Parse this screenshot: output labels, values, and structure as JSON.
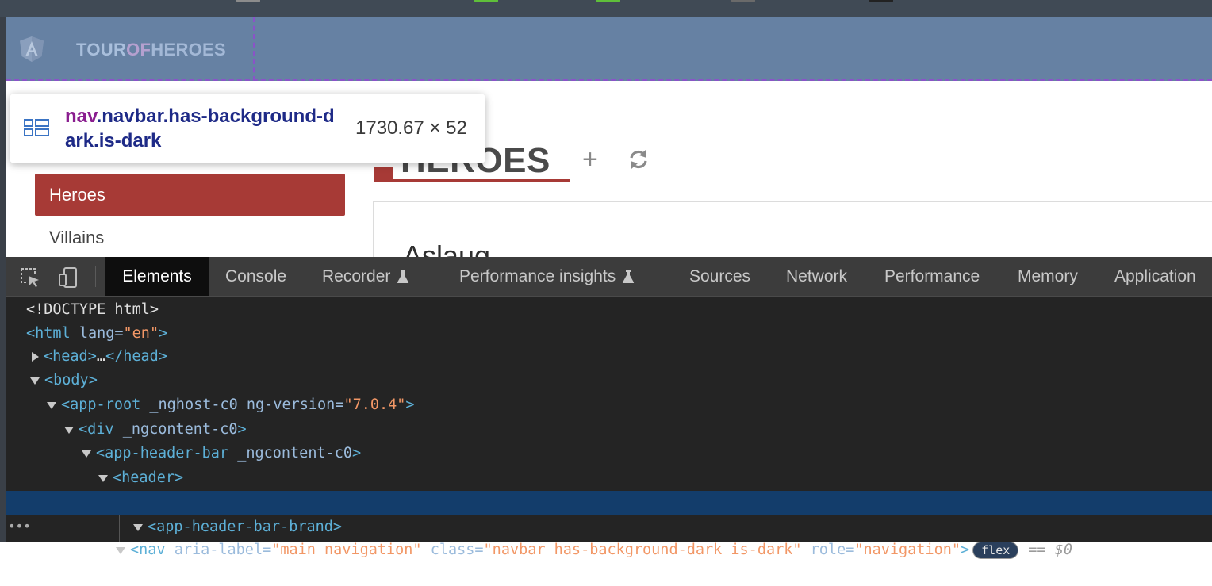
{
  "colors": {
    "navbar_bg": "#6681a3",
    "highlight_outline": "#8a53c8",
    "accent_red": "#a73a36",
    "devtools_bg": "#242424",
    "selected_row": "#133d6b"
  },
  "topstrip": {
    "chips": [
      {
        "color": "#8c8c8c"
      },
      {
        "color": "#5fbf3a"
      },
      {
        "color": "#5fbf3a"
      },
      {
        "color": "#6a6a6a"
      },
      {
        "color": "#222222"
      }
    ]
  },
  "navbar": {
    "brand": {
      "part1": "TOUR",
      "part2": "OF",
      "part3": "HEROES",
      "logo_icon": "angular-logo-icon"
    }
  },
  "tooltip": {
    "tag": "nav",
    "classes": ".navbar.has-background-dark.is-dark",
    "size": "1730.67 × 52",
    "icon": "flex-layout-icon"
  },
  "sidebar": {
    "items": [
      {
        "label": "Heroes",
        "active": true
      },
      {
        "label": "Villains",
        "active": false
      }
    ]
  },
  "main": {
    "title": "HEROES",
    "add_icon": "plus-icon",
    "refresh_icon": "refresh-icon",
    "first_card_name": "Aslaug"
  },
  "devtools": {
    "toolbar_icons": [
      "inspect-element-icon",
      "device-toolbar-icon"
    ],
    "tabs": [
      {
        "label": "Elements",
        "active": true
      },
      {
        "label": "Console"
      },
      {
        "label": "Recorder",
        "flask": true
      },
      {
        "label": "Performance insights",
        "flask": true
      },
      {
        "label": "Sources"
      },
      {
        "label": "Network"
      },
      {
        "label": "Performance"
      },
      {
        "label": "Memory"
      },
      {
        "label": "Application"
      }
    ],
    "dom": {
      "doctype": "<!DOCTYPE html>",
      "html_open": "<html",
      "html_attr": " lang=",
      "html_val": "\"en\"",
      "html_close": ">",
      "head": "<head>",
      "head_ellipsis": "…",
      "head_close": "</head>",
      "body": "<body>",
      "approot_tag": "<app-root",
      "approot_attr1": " _nghost-c0 ng-version=",
      "approot_val": "\"7.0.4\"",
      "approot_close": ">",
      "div_tag": "<div",
      "div_attr": " _ngcontent-c0",
      "div_close": ">",
      "hb_tag": "<app-header-bar",
      "hb_attr": " _ngcontent-c0",
      "hb_close": ">",
      "header": "<header>",
      "nav_tag": "<nav",
      "nav_attr1": " aria-label=",
      "nav_val1": "\"main navigation\"",
      "nav_attr2": " class=",
      "nav_val2": "\"navbar has-background-dark is-dark\"",
      "nav_attr3": " role=",
      "nav_val3": "\"navigation\"",
      "nav_close": ">",
      "flex_badge": "flex",
      "eq": "==",
      "dollar": "$0",
      "row_dots": "•••",
      "brand_tag": "<app-header-bar-brand>"
    }
  }
}
